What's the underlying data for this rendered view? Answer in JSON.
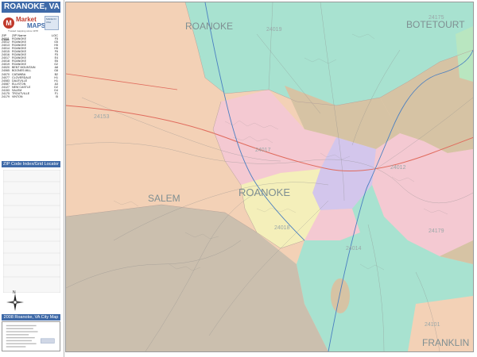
{
  "sidebar": {
    "title": "ROANOKE, VA",
    "logo": {
      "mark": "M",
      "brand_top": "Market",
      "brand_bottom": "MAPS",
      "tagline": "Trusted mapping since 1978",
      "badge": "MADE IN USA"
    },
    "zip_header": {
      "code": "ZIP Code",
      "name": "ZIP Name",
      "loc": "LOC"
    },
    "zip_rows": [
      {
        "code": "24011",
        "name": "ROANOKE",
        "loc": "F5"
      },
      {
        "code": "24012",
        "name": "ROANOKE",
        "loc": "G5"
      },
      {
        "code": "24013",
        "name": "ROANOKE",
        "loc": "H5"
      },
      {
        "code": "24014",
        "name": "ROANOKE",
        "loc": "H5"
      },
      {
        "code": "24015",
        "name": "ROANOKE",
        "loc": "F6"
      },
      {
        "code": "24016",
        "name": "ROANOKE",
        "loc": "F5"
      },
      {
        "code": "24017",
        "name": "ROANOKE",
        "loc": "E4"
      },
      {
        "code": "24018",
        "name": "ROANOKE",
        "loc": "E6"
      },
      {
        "code": "24019",
        "name": "ROANOKE",
        "loc": "G2"
      },
      {
        "code": "24020",
        "name": "BENT MOUNTAIN",
        "loc": "A8"
      },
      {
        "code": "24065",
        "name": "BOONES MILL",
        "loc": "G8"
      },
      {
        "code": "24070",
        "name": "CATAWBA",
        "loc": "B2"
      },
      {
        "code": "24077",
        "name": "CLOVERDALE",
        "loc": "H1"
      },
      {
        "code": "24083",
        "name": "DALEVILLE",
        "loc": "H1"
      },
      {
        "code": "24087",
        "name": "ELLISTON",
        "loc": "A3"
      },
      {
        "code": "24127",
        "name": "NEW CASTLE",
        "loc": "D2"
      },
      {
        "code": "24153",
        "name": "SALEM",
        "loc": "D4"
      },
      {
        "code": "24175",
        "name": "TROUTVILLE",
        "loc": "F1"
      },
      {
        "code": "24179",
        "name": "VINTON",
        "loc": "I5"
      }
    ],
    "locator_title": "ZIP Code Index/Grid Locator",
    "compass_letter": "N",
    "info_title": "2008 Roanoke, VA City Map"
  },
  "map": {
    "counties": {
      "roanoke": "ROANOKE",
      "botetourt": "BOTETOURT",
      "franklin": "FRANKLIN"
    },
    "cities": {
      "roanoke": "ROANOKE",
      "salem": "SALEM"
    },
    "zips": {
      "z24019": "24019",
      "z24175": "24175",
      "z24153": "24153",
      "z24017": "24017",
      "z24179": "24179",
      "z24014": "24014",
      "z24101": "24101",
      "z24012": "24012",
      "z24018": "24018"
    },
    "colors": {
      "teal": "#a8e2d0",
      "peach": "#f3d1b6",
      "pink": "#f4c9d2",
      "tan": "#d6c3a4",
      "gray_beige": "#cbbfae",
      "yellow": "#f4efba",
      "lavender": "#d3c6ec",
      "green": "#b9e6c0",
      "label_gray": "#7f8f92",
      "header_blue": "#3f6aa8"
    }
  }
}
